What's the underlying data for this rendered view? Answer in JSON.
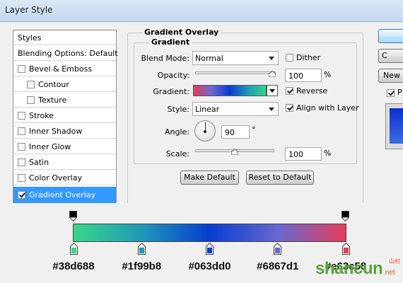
{
  "window": {
    "title": "Layer Style"
  },
  "sidebar": {
    "items": [
      {
        "label": "Styles",
        "has_checkbox": false,
        "checked": false,
        "selected": false
      },
      {
        "label": "Blending Options: Default",
        "has_checkbox": false,
        "checked": false,
        "selected": false
      },
      {
        "label": "Bevel & Emboss",
        "has_checkbox": true,
        "checked": false,
        "selected": false
      },
      {
        "label": "Contour",
        "has_checkbox": true,
        "checked": false,
        "selected": false
      },
      {
        "label": "Texture",
        "has_checkbox": true,
        "checked": false,
        "selected": false
      },
      {
        "label": "Stroke",
        "has_checkbox": true,
        "checked": false,
        "selected": false
      },
      {
        "label": "Inner Shadow",
        "has_checkbox": true,
        "checked": false,
        "selected": false
      },
      {
        "label": "Inner Glow",
        "has_checkbox": true,
        "checked": false,
        "selected": false
      },
      {
        "label": "Satin",
        "has_checkbox": true,
        "checked": false,
        "selected": false
      },
      {
        "label": "Color Overlay",
        "has_checkbox": true,
        "checked": false,
        "selected": false
      },
      {
        "label": "Gradient Overlay",
        "has_checkbox": true,
        "checked": true,
        "selected": true
      }
    ]
  },
  "panel": {
    "group_title": "Gradient Overlay",
    "subgroup_title": "Gradient",
    "blend_mode": {
      "label": "Blend Mode:",
      "value": "Normal"
    },
    "dither": {
      "label": "Dither",
      "checked": false
    },
    "opacity": {
      "label": "Opacity:",
      "value": "100",
      "unit": "%",
      "slider_fraction": 1.0
    },
    "gradient": {
      "label": "Gradient:"
    },
    "reverse": {
      "label": "Reverse",
      "checked": true
    },
    "style": {
      "label": "Style:",
      "value": "Linear"
    },
    "align_with_layer": {
      "label": "Align with Layer",
      "checked": true
    },
    "angle": {
      "label": "Angle:",
      "value": "90",
      "unit": "°"
    },
    "scale": {
      "label": "Scale:",
      "value": "100",
      "unit": "%",
      "slider_fraction": 0.5
    },
    "make_default": "Make Default",
    "reset_to_default": "Reset to Default"
  },
  "right_buttons": {
    "cancel_partial": "C",
    "new_partial": "New",
    "preview_partial": "P",
    "preview_checked": true
  },
  "gradient_editor": {
    "stops": [
      {
        "hex": "#38d688",
        "color": "#38d688",
        "position": 0.0
      },
      {
        "hex": "#1f99b8",
        "color": "#1f99b8",
        "position": 0.25
      },
      {
        "hex": "#063dd0",
        "color": "#063dd0",
        "position": 0.5
      },
      {
        "hex": "#6867d1",
        "color": "#6867d1",
        "position": 0.75
      },
      {
        "hex": "#e63c58",
        "color": "#e63c58",
        "position": 1.0
      }
    ],
    "visible_hex_labels": [
      "#38d688",
      "#1f99b8",
      "#063dd0",
      "#6867d1",
      "#e63c58"
    ]
  },
  "watermark": {
    "text": "shancun",
    "suffix": ".net",
    "small": "山村"
  }
}
